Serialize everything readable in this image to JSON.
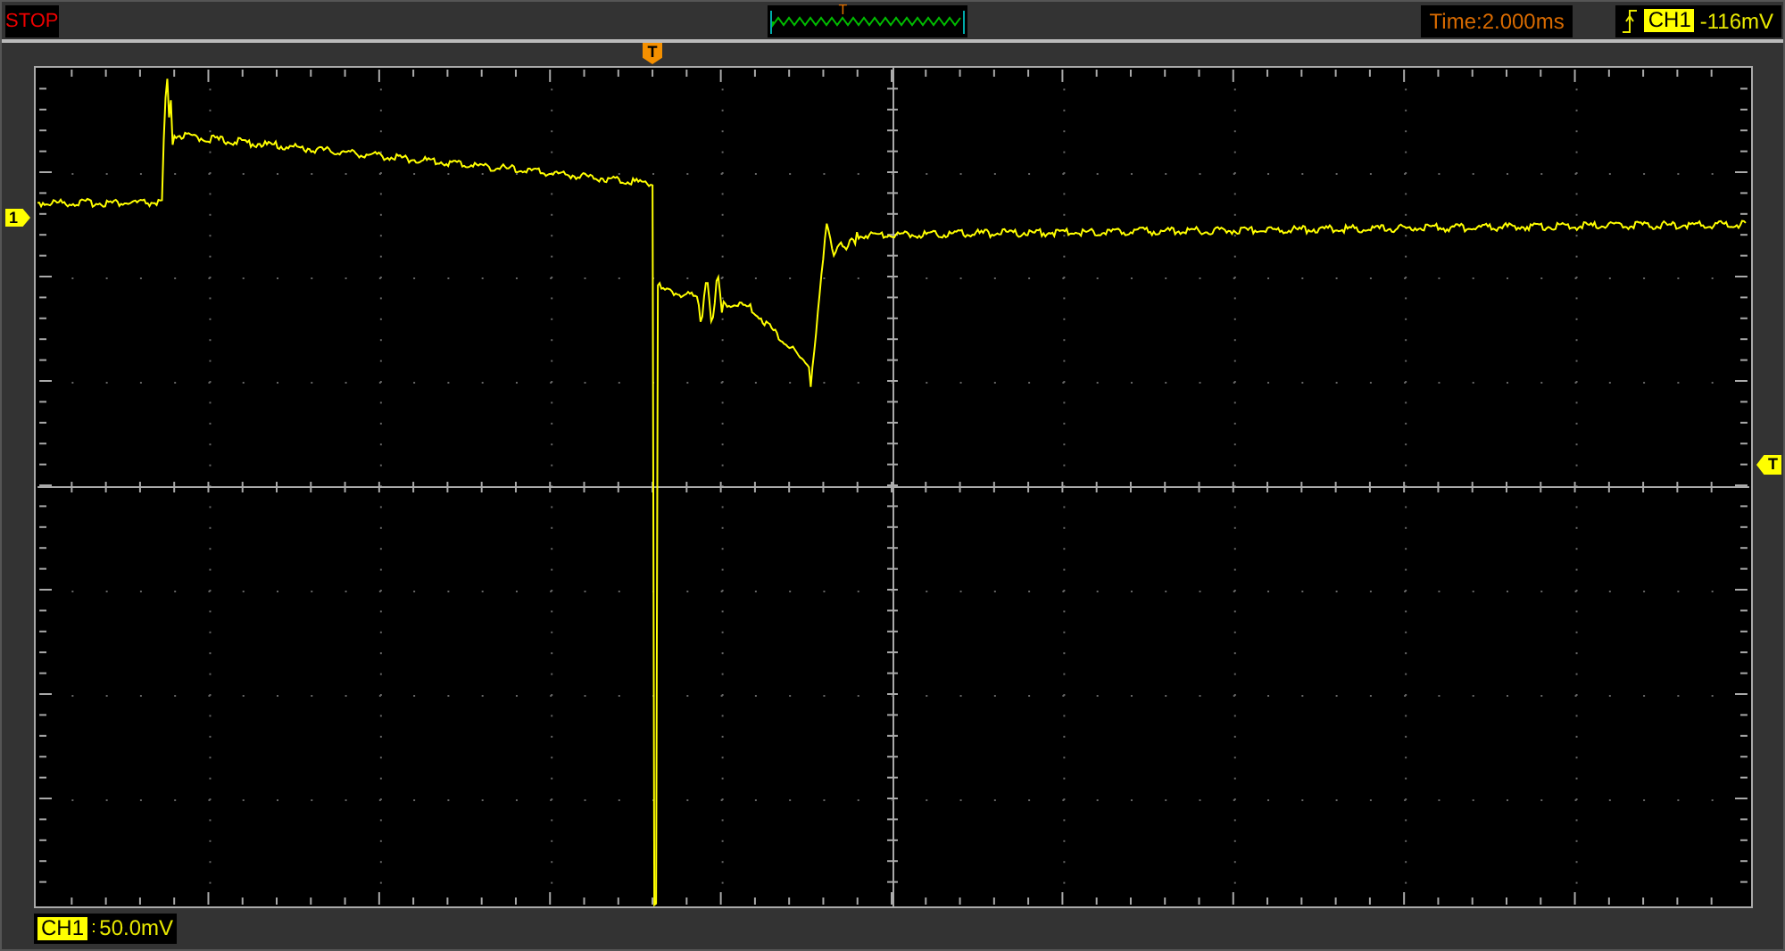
{
  "status": "STOP",
  "overview": {
    "trigger_mark": "T"
  },
  "timebase": "Time:2.000ms",
  "trigger": {
    "channel": "CH1",
    "level": "-116mV"
  },
  "trigger_position_marker": "T",
  "channel_marker": "1",
  "trigger_level_marker": "T",
  "channel_scale": {
    "channel": "CH1",
    "scale": "50.0mV"
  }
}
